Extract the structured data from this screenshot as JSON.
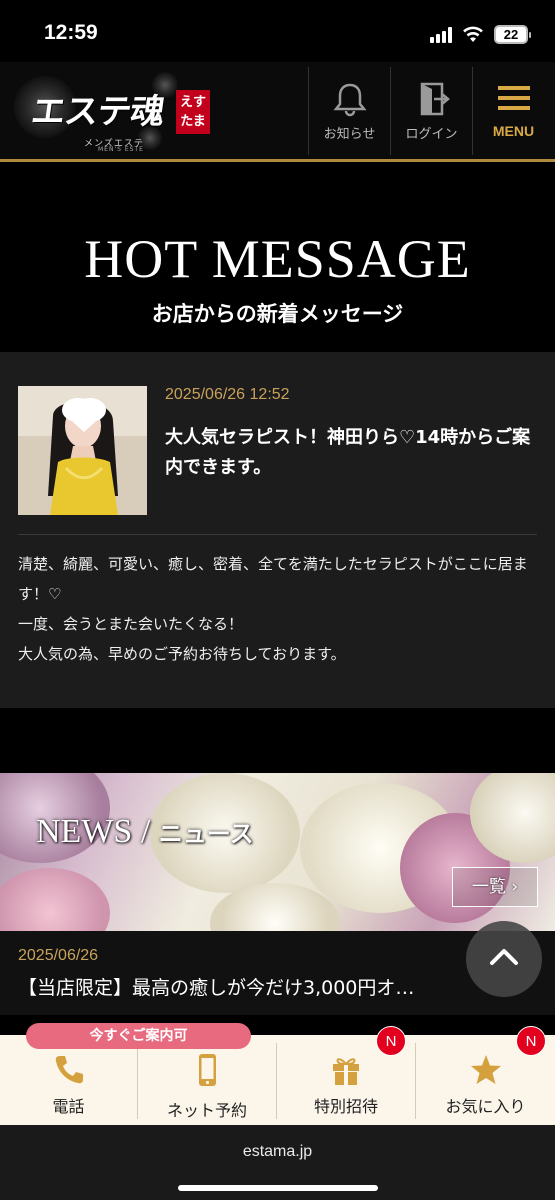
{
  "status_bar": {
    "time": "12:59",
    "battery": "22"
  },
  "header": {
    "logo_text": "エステ魂",
    "logo_badge_line1": "えす",
    "logo_badge_line2": "たま",
    "logo_sub": "メンズエステ",
    "logo_sub2": "MEN'S ESTE",
    "nav": [
      {
        "label": "お知らせ",
        "icon": "bell-icon"
      },
      {
        "label": "ログイン",
        "icon": "login-door-icon"
      },
      {
        "label": "MENU",
        "icon": "hamburger-icon"
      }
    ]
  },
  "hot_message": {
    "title": "HOT MESSAGE",
    "subtitle": "お店からの新着メッセージ",
    "date": "2025/06/26 12:52",
    "headline": "大人気セラピスト！神田りら♡14時からご案内できます。",
    "body_lines": [
      "清楚、綺麗、可愛い、癒し、密着、全てを満たしたセラピストがここに居ます！♡",
      "一度、会うとまた会いたくなる！",
      "大人気の為、早めのご予約お待ちしております。"
    ]
  },
  "news": {
    "title_en": "NEWS",
    "title_sep": " / ",
    "title_jp": "ニュース",
    "more_label": "一覧 ›",
    "item": {
      "date": "2025/06/26",
      "text": "【当店限定】最高の癒しが今だけ3,000円オ…"
    }
  },
  "bottom_bar": {
    "availability": "今すぐご案内可",
    "badge": "N",
    "items": [
      {
        "label": "電話",
        "icon": "phone-icon"
      },
      {
        "label": "ネット予約",
        "icon": "smartphone-icon"
      },
      {
        "label": "特別招待",
        "icon": "gift-icon"
      },
      {
        "label": "お気に入り",
        "icon": "star-icon"
      }
    ]
  },
  "browser": {
    "url": "estama.jp"
  },
  "colors": {
    "accent_gold": "#c9a25a",
    "menu_gold": "#d8a944",
    "badge_red": "#e3001e",
    "availability_pink": "#e86a7f"
  }
}
